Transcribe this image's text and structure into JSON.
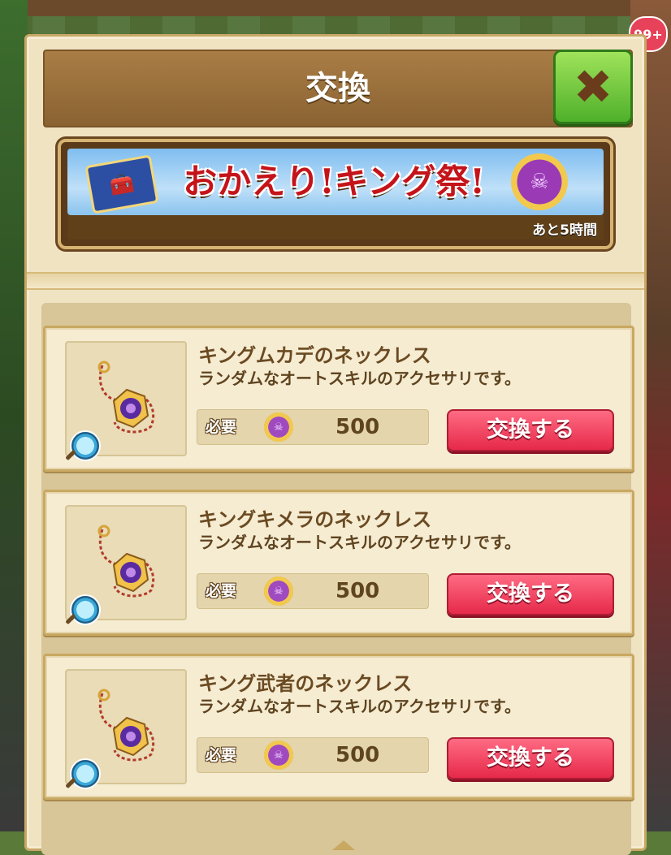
{
  "dialog": {
    "title": "交換"
  },
  "background": {
    "badge": "99+"
  },
  "banner": {
    "event_title": "おかえり!キング祭!",
    "countdown": "あと5時間"
  },
  "items": [
    {
      "name": "キングムカデのネックレス",
      "description": "ランダムなオートスキルのアクセサリです。",
      "cost_label": "必要",
      "cost": "500",
      "button": "交換する"
    },
    {
      "name": "キングキメラのネックレス",
      "description": "ランダムなオートスキルのアクセサリです。",
      "cost_label": "必要",
      "cost": "500",
      "button": "交換する"
    },
    {
      "name": "キング武者のネックレス",
      "description": "ランダムなオートスキルのアクセサリです。",
      "cost_label": "必要",
      "cost": "500",
      "button": "交換する"
    }
  ],
  "icons": {
    "close": "close-icon",
    "medal": "king-medal-icon",
    "magnifier": "magnifier-icon",
    "ticket": "ticket-icon"
  },
  "colors": {
    "title_bar": "#8a6232",
    "close_button": "#4fb02a",
    "exchange_button": "#e6294a",
    "card_bg": "#f5ecd2"
  }
}
